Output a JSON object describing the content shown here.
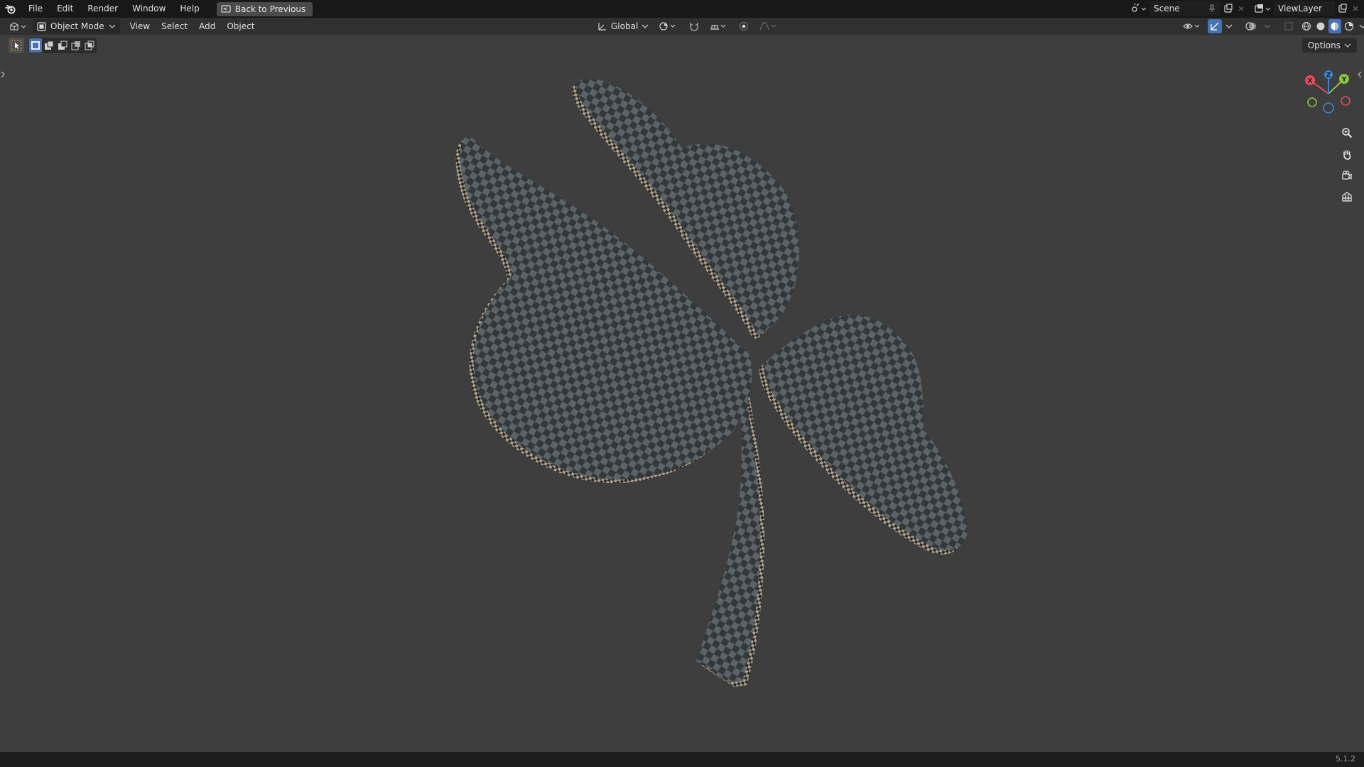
{
  "app": {
    "name": "Blender",
    "version": "5.1.2"
  },
  "topbar": {
    "menus": [
      "File",
      "Edit",
      "Render",
      "Window",
      "Help"
    ],
    "back_label": "Back to Previous",
    "scene_label": "Scene",
    "viewlayer_label": "ViewLayer"
  },
  "header": {
    "mode_label": "Object Mode",
    "menus": [
      "View",
      "Select",
      "Add",
      "Object"
    ],
    "transform_orientation": "Global"
  },
  "viewport": {
    "options_label": "Options",
    "gizmo_axes": {
      "x": "X",
      "y": "Y",
      "z": "Z"
    },
    "nav_icons": [
      "zoom-icon",
      "hand-pan-icon",
      "camera-icon",
      "grid-ortho-icon"
    ],
    "object": "clover-mesh-checker-texture"
  },
  "colors": {
    "x_axis": "#e64a5b",
    "y_axis": "#8bc53f",
    "z_axis": "#3d84d6",
    "accent": "#4772b3",
    "viewport_bg": "#3e3e3e"
  }
}
